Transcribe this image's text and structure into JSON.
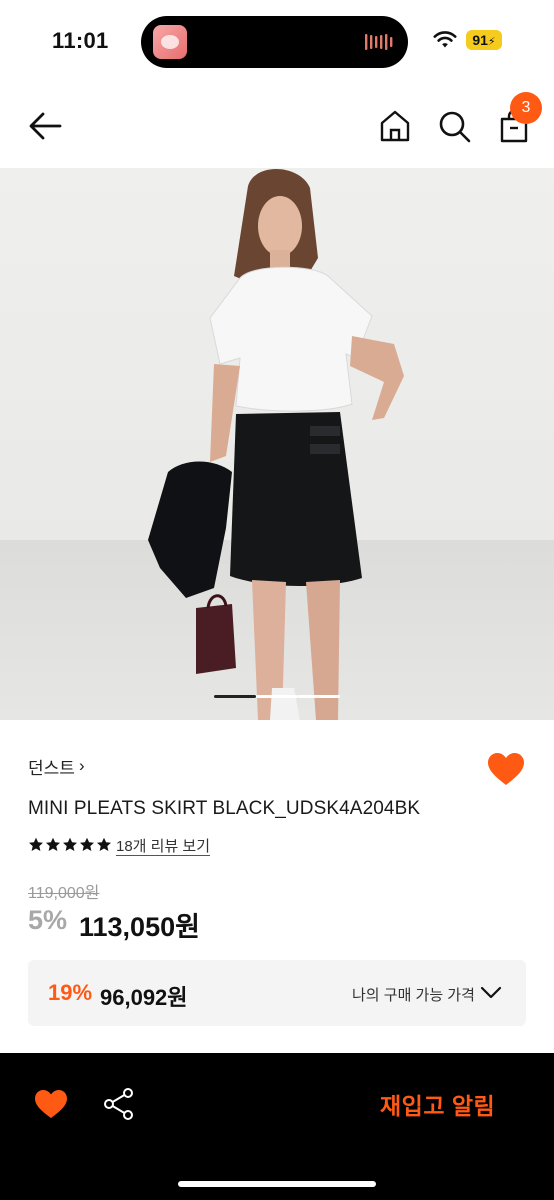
{
  "status_bar": {
    "time": "11:01",
    "battery": "91",
    "colors": {
      "battery": "#f5cc1e"
    },
    "icons": [
      "wifi-icon",
      "battery-icon"
    ]
  },
  "header": {
    "cart_badge": "3",
    "icons": [
      "back-arrow-icon",
      "home-icon",
      "search-icon",
      "shopping-bag-icon"
    ],
    "colors": {
      "badge": "#ff5a14"
    }
  },
  "gallery": {
    "image_count": 3,
    "active_index": 0
  },
  "product": {
    "brand": "던스트",
    "brand_chevron": "›",
    "name": "MINI PLEATS SKIRT BLACK_UDSK4A204BK",
    "rating_stars": 5,
    "review_link": "18개 리뷰 보기",
    "original_price": "119,000원",
    "discount_rate": "5%",
    "sale_price": "113,050원",
    "wishlisted": true
  },
  "benefit": {
    "rate": "19%",
    "price": "96,092원",
    "label": "나의 구매 가능 가격"
  },
  "bottom_bar": {
    "restock_label": "재입고 알림",
    "icons": [
      "heart-icon",
      "share-icon"
    ]
  },
  "colors": {
    "accent": "#ff5a14",
    "text": "#111111",
    "muted": "#9a9a9a",
    "benefit_bg": "#f4f4f5"
  }
}
